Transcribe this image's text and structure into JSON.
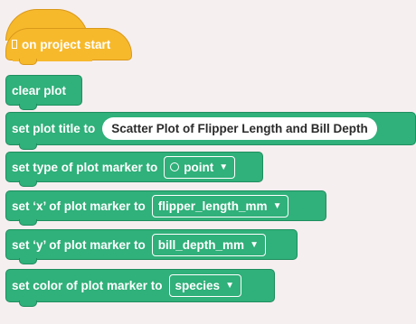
{
  "hat_block": {
    "label": "on project start"
  },
  "blocks": {
    "clear_plot": "clear plot",
    "set_title": {
      "label": "set plot title to",
      "value": "Scatter Plot of Flipper Length and Bill Depth"
    },
    "marker_type": {
      "label": "set type of plot marker to",
      "value": "point"
    },
    "x_marker": {
      "label": "set ‘x’ of plot marker to",
      "value": "flipper_length_mm"
    },
    "y_marker": {
      "label": "set ‘y’ of plot marker to",
      "value": "bill_depth_mm"
    },
    "color_marker": {
      "label": "set color of plot marker to",
      "value": "species"
    }
  },
  "icons": {
    "hat": "flag-icon",
    "point": "circle-icon",
    "dropdown": "caret-down-icon"
  },
  "colors": {
    "background": "#f6eff0",
    "event_block": "#f7b92c",
    "plot_block": "#30b07a",
    "plot_block_border": "#1f8e5f"
  }
}
